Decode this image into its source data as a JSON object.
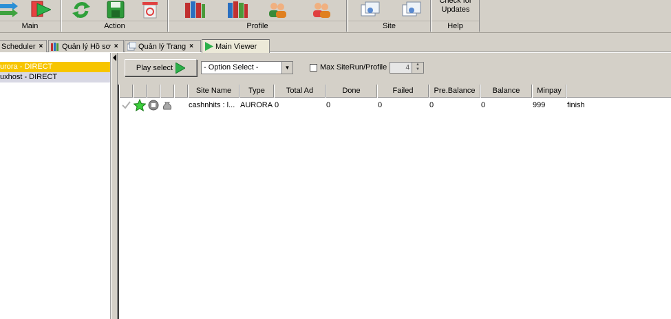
{
  "ribbon": {
    "groups": [
      {
        "label": "Main"
      },
      {
        "label": "Action"
      },
      {
        "label": "Profile"
      },
      {
        "label": "Site"
      },
      {
        "label": "Help"
      }
    ],
    "help_button_label_line1": "Check for",
    "help_button_label_line2": "Updates"
  },
  "tabs": [
    {
      "label": "Scheduler",
      "icon": "scheduler-icon"
    },
    {
      "label": "Quản lý Hồ sơ",
      "icon": "folders-icon"
    },
    {
      "label": "Quản lý Trang",
      "icon": "pages-icon"
    },
    {
      "label": "Main Viewer",
      "icon": "play-icon",
      "active": true
    }
  ],
  "left_list": {
    "items": [
      {
        "label": "urora   - DIRECT",
        "selected": true
      },
      {
        "label": "uxhost   - DIRECT",
        "selected": false
      }
    ]
  },
  "toolbar": {
    "play_label": "Play select",
    "option_select_value": "- Option Select -",
    "max_label": "Max SiteRun/Profile",
    "max_value": "4"
  },
  "grid": {
    "columns": [
      "",
      "",
      "",
      "",
      "",
      "Site Name",
      "Type",
      "Total Ad",
      "Done",
      "Failed",
      "Pre.Balance",
      "Balance",
      "Minpay",
      ""
    ],
    "rows": [
      {
        "site_name": "cashnhits : l...",
        "type": "AURORA",
        "total_ad": "0",
        "done": "0",
        "failed": "0",
        "pre_balance": "0",
        "balance": "0",
        "minpay": "999",
        "status": "finish"
      }
    ]
  },
  "colors": {
    "selected_row": "#f7c500",
    "second_row": "#d8d8e4",
    "chrome": "#d4d0c8"
  }
}
